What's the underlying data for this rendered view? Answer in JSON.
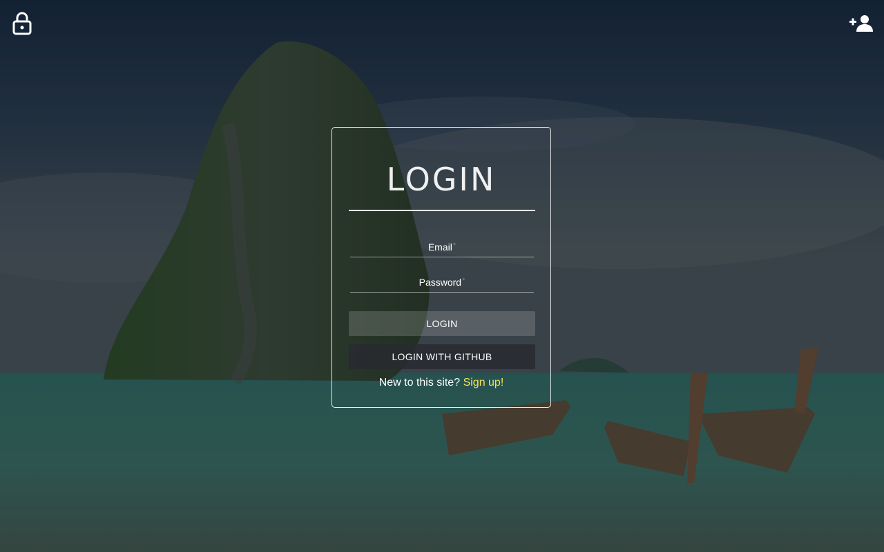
{
  "header": {
    "left_icon": "lock-open-icon",
    "right_icon": "add-user-icon"
  },
  "login_card": {
    "title": "LOGIN",
    "email_label": "Email",
    "password_label": "Password",
    "required_marker": "*",
    "login_button": "LOGIN",
    "github_button": "LOGIN WITH GITHUB",
    "signup_prompt": "New to this site?",
    "signup_link": "Sign up!"
  },
  "colors": {
    "accent_link": "#f3e35a",
    "text": "#ffffff",
    "overlay": "#1b2a3a"
  }
}
